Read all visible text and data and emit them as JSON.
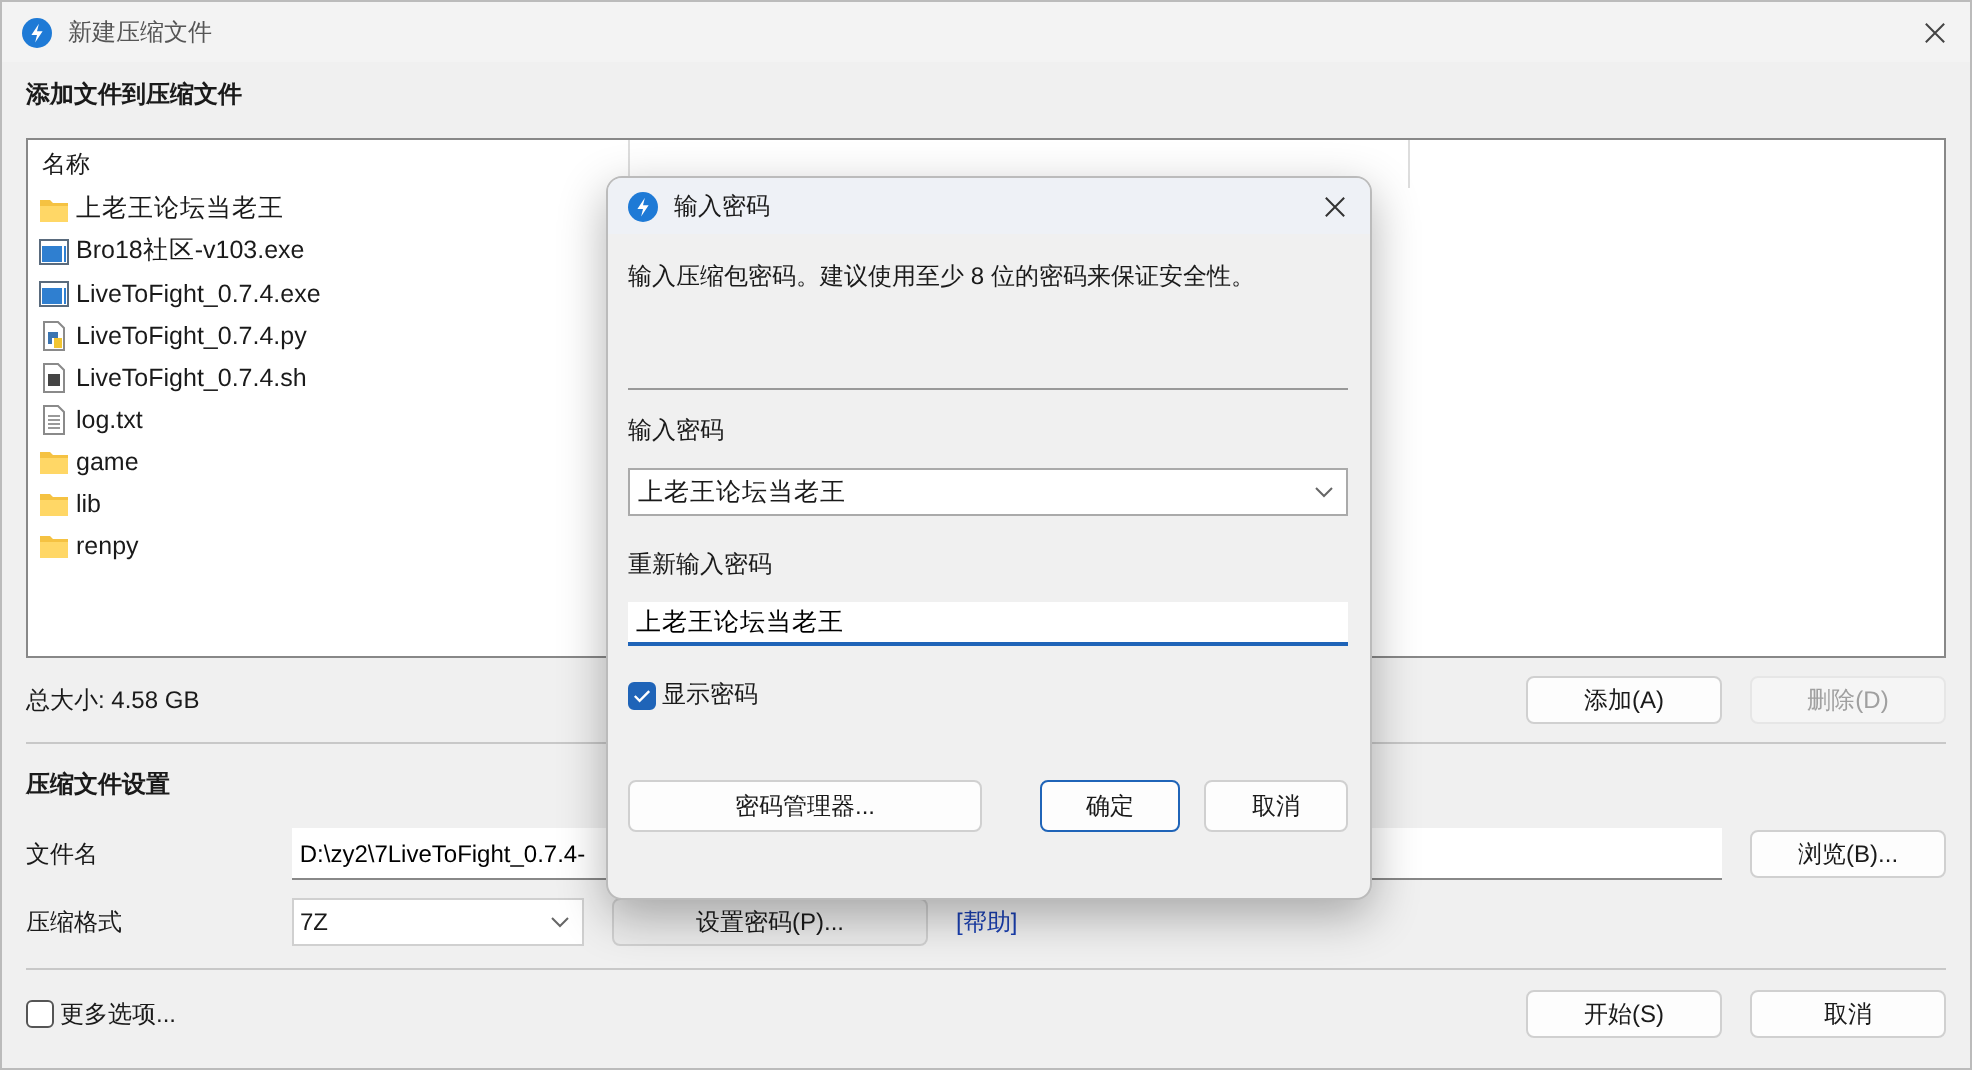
{
  "window": {
    "title": "新建压缩文件"
  },
  "add_section": {
    "heading": "添加文件到压缩文件"
  },
  "file_list": {
    "columns": [
      "名称"
    ],
    "rows": [
      {
        "name": "上老王论坛当老王",
        "kind": "folder"
      },
      {
        "name": "Bro18社区-v103.exe",
        "kind": "exe"
      },
      {
        "name": "LiveToFight_0.7.4.exe",
        "kind": "exe"
      },
      {
        "name": "LiveToFight_0.7.4.py",
        "kind": "py"
      },
      {
        "name": "LiveToFight_0.7.4.sh",
        "kind": "sh"
      },
      {
        "name": "log.txt",
        "kind": "txt"
      },
      {
        "name": "game",
        "kind": "folder"
      },
      {
        "name": "lib",
        "kind": "folder"
      },
      {
        "name": "renpy",
        "kind": "folder"
      }
    ]
  },
  "total_size": "总大小: 4.58 GB",
  "list_buttons": [
    {
      "label": "添加(A)",
      "disabled": false
    },
    {
      "label": "删除(D)",
      "disabled": true
    }
  ],
  "settings": {
    "heading": "压缩文件设置",
    "filename_label": "文件名",
    "filename_value": "D:\\zy2\\7LiveToFight_0.7.4-",
    "browse_button": "浏览(B)...",
    "format_label": "压缩格式",
    "format_value": "7Z",
    "password_button": "设置密码(P)...",
    "help_link": "[帮助]"
  },
  "more_options": {
    "label": "更多选项...",
    "checked": false
  },
  "footer_buttons": [
    "开始(S)",
    "取消"
  ],
  "dialog": {
    "title": "输入密码",
    "message": "输入压缩包密码。建议使用至少 8 位的密码来保证安全性。",
    "password_label": "输入密码",
    "password_value": "上老王论坛当老王",
    "confirm_label": "重新输入密码",
    "confirm_value": "上老王论坛当老王",
    "show_password": {
      "label": "显示密码",
      "checked": true
    },
    "manager_button": "密码管理器...",
    "ok_button": "确定",
    "cancel_button": "取消"
  }
}
